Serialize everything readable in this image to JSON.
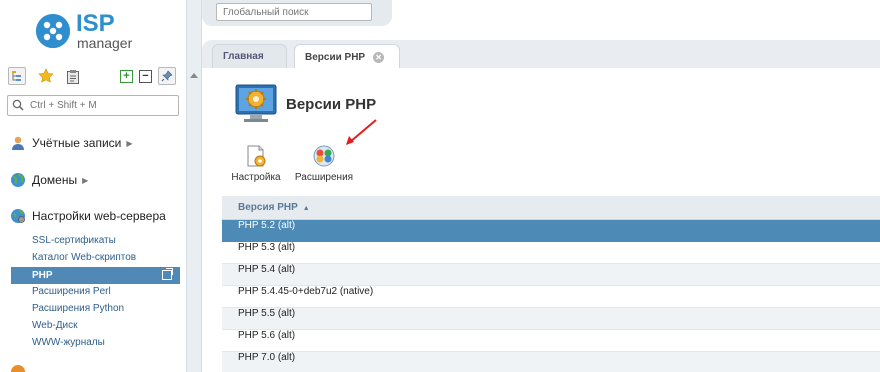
{
  "app": {
    "logo_isp": "ISP",
    "logo_manager": "manager"
  },
  "left_panel": {
    "search_placeholder": "Ctrl + Shift + M",
    "sections": [
      {
        "label": "Учётные записи",
        "icon": "users-icon"
      },
      {
        "label": "Домены",
        "icon": "globe-icon"
      },
      {
        "label": "Настройки web-сервера",
        "icon": "web-settings-icon"
      }
    ],
    "web_server_items": [
      "SSL-сертификаты",
      "Каталог Web-скриптов",
      "PHP",
      "Расширения Perl",
      "Расширения Python",
      "Web-Диск",
      "WWW-журналы"
    ],
    "selected_item": "PHP"
  },
  "topbar": {
    "global_search_placeholder": "Глобальный поиск"
  },
  "tabs": [
    {
      "label": "Главная",
      "active": false
    },
    {
      "label": "Версии PHP",
      "active": true
    }
  ],
  "main": {
    "title": "Версии PHP",
    "actions": [
      {
        "label": "Настройка",
        "icon": "settings-icon"
      },
      {
        "label": "Расширения",
        "icon": "extensions-icon"
      }
    ],
    "grid": {
      "column_header": "Версия PHP",
      "sort": "ascending",
      "rows": [
        "PHP 5.2 (alt)",
        "PHP 5.3 (alt)",
        "PHP 5.4 (alt)",
        "PHP 5.4.45-0+deb7u2 (native)",
        "PHP 5.5 (alt)",
        "PHP 5.6 (alt)",
        "PHP 7.0 (alt)"
      ],
      "selected_row": "PHP 5.2 (alt)"
    }
  },
  "colors": {
    "brand": "#2f8fce",
    "selection": "#4e8ab6",
    "annotation_arrow": "#e02020"
  }
}
